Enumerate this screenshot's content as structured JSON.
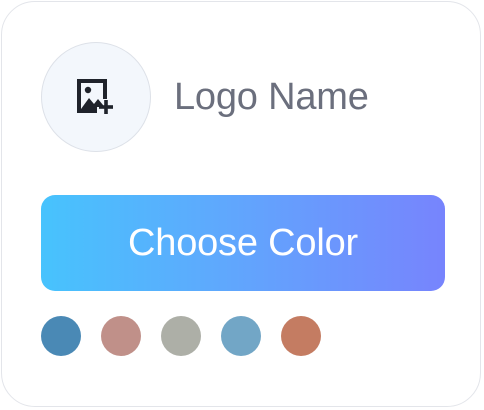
{
  "logo": {
    "icon": "image-add-icon",
    "name": "Logo Name"
  },
  "choose_button": {
    "label": "Choose Color"
  },
  "colors": {
    "gradient_start": "#47c3fd",
    "gradient_end": "#7784fd",
    "swatches": [
      "#4a89b5",
      "#c09089",
      "#adafa7",
      "#72a6c6",
      "#c47c62"
    ]
  }
}
